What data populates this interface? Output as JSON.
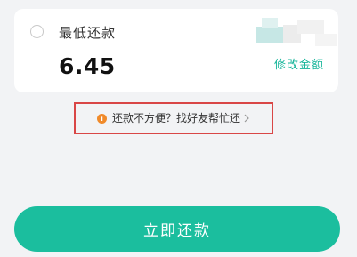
{
  "repayment": {
    "option_label": "最低还款",
    "amount": "6.45",
    "modify_link": "修改金额"
  },
  "help": {
    "text": "还款不方便？找好友帮忙还",
    "icon": "info-icon",
    "chevron": "chevron-right-icon"
  },
  "actions": {
    "pay_now": "立即还款"
  },
  "colors": {
    "accent": "#1bbe9e",
    "link": "#16b59a",
    "highlight_border": "#d94646",
    "info": "#f08a2a",
    "background": "#f2f3f5"
  }
}
